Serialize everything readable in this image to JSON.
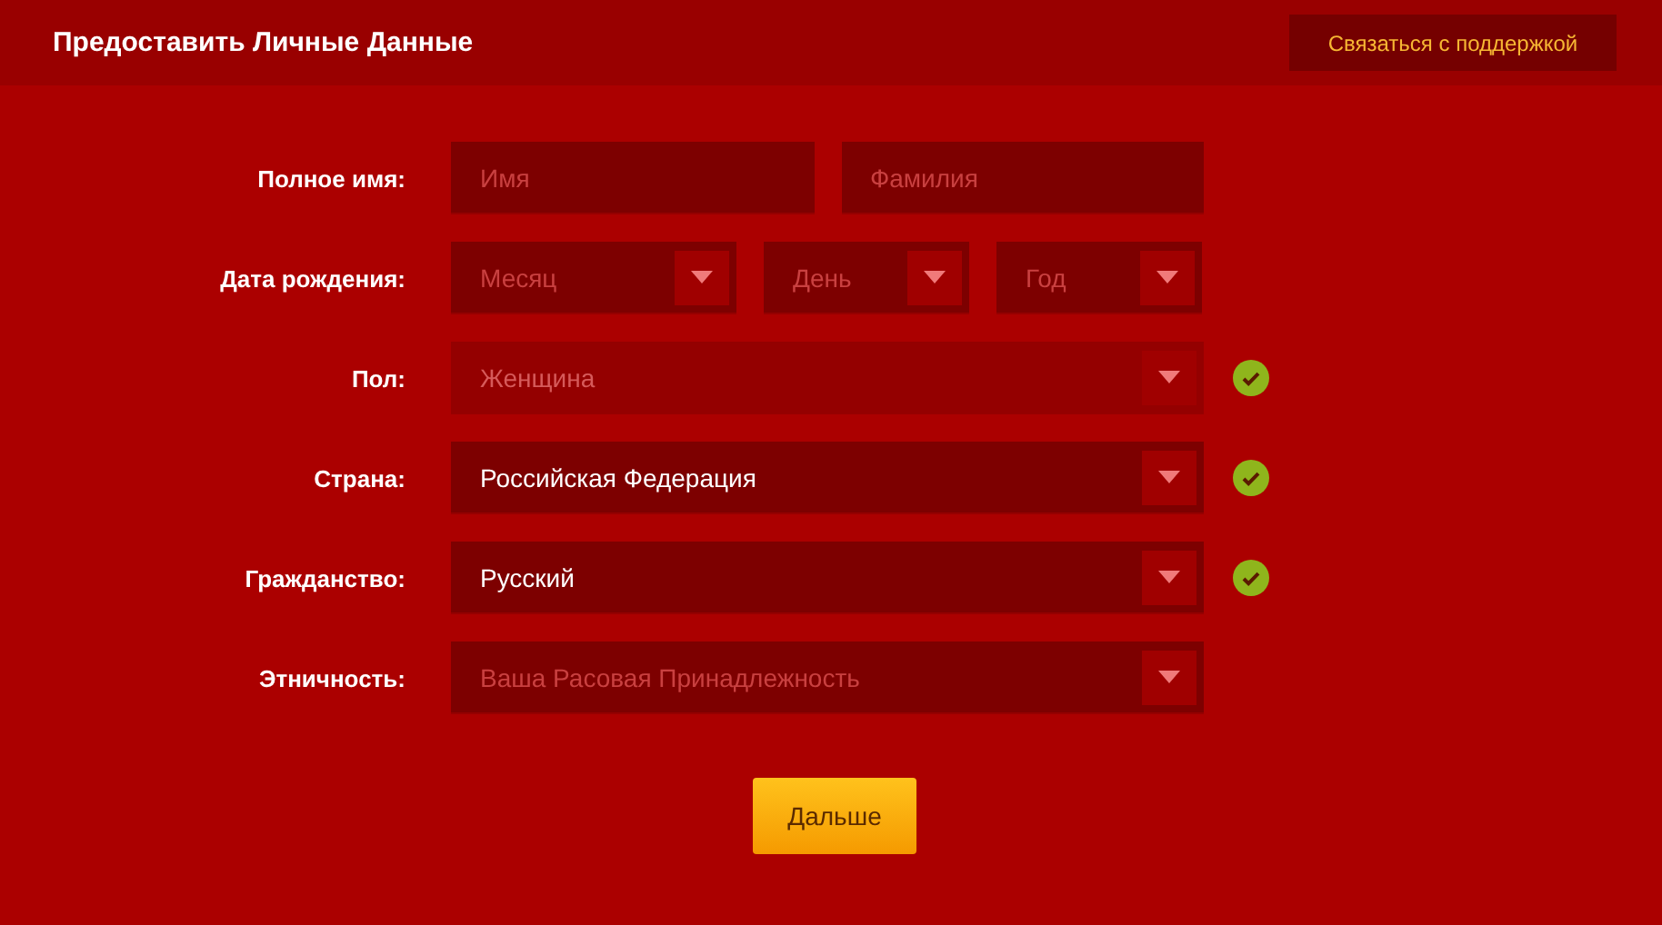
{
  "header": {
    "title": "Предоставить Личные Данные",
    "support_button": "Связаться с поддержкой"
  },
  "rows": [
    {
      "label": "Полное имя:",
      "valid": false,
      "fields": [
        {
          "kind": "input",
          "placeholder": "Имя",
          "disabled": false
        },
        {
          "kind": "input",
          "placeholder": "Фамилия",
          "disabled": false
        }
      ]
    },
    {
      "label": "Дата рождения:",
      "valid": false,
      "fields": [
        {
          "kind": "select",
          "placeholder": "Месяц",
          "disabled": false
        },
        {
          "kind": "select",
          "placeholder": "День",
          "disabled": false
        },
        {
          "kind": "select",
          "placeholder": "Год",
          "disabled": false
        }
      ]
    },
    {
      "label": "Пол:",
      "valid": true,
      "fields": [
        {
          "kind": "select",
          "value": "Женщина",
          "disabled": true
        }
      ]
    },
    {
      "label": "Страна:",
      "valid": true,
      "fields": [
        {
          "kind": "select",
          "value": "Российская Федерация",
          "disabled": false
        }
      ]
    },
    {
      "label": "Гражданство:",
      "valid": true,
      "fields": [
        {
          "kind": "select",
          "value": "Русский",
          "disabled": false
        }
      ]
    },
    {
      "label": "Этничность:",
      "valid": false,
      "fields": [
        {
          "kind": "select",
          "placeholder": "Ваша Расовая Принадлежность",
          "disabled": false
        }
      ]
    }
  ],
  "next_button": "Дальше"
}
